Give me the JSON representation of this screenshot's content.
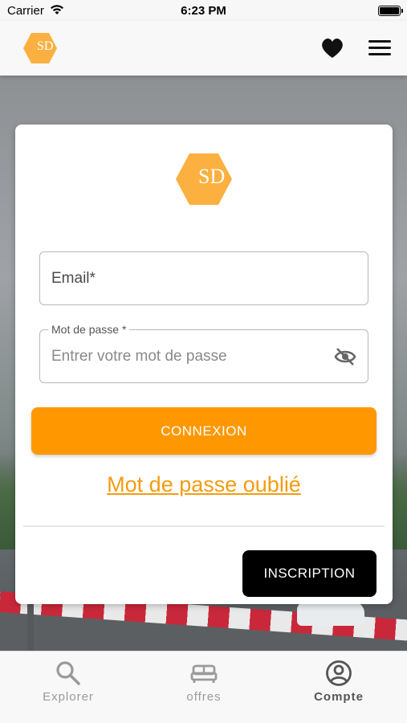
{
  "status_bar": {
    "carrier": "Carrier",
    "time": "6:23 PM"
  },
  "app_bar": {
    "logo_text": "SD",
    "icons": [
      "heart-icon",
      "menu-icon"
    ]
  },
  "login": {
    "logo_text": "SD",
    "email_placeholder": "Email*",
    "email_value": "",
    "password_label": "Mot de passe *",
    "password_placeholder": "Entrer votre mot de passe",
    "password_value": "",
    "connexion_label": "CONNEXION",
    "forgot_label": "Mot de passe oublié",
    "inscription_label": "INSCRIPTION"
  },
  "bottom_nav": {
    "items": [
      {
        "label": "Explorer",
        "icon": "search-icon",
        "active": false
      },
      {
        "label": "offres",
        "icon": "bed-icon",
        "active": false
      },
      {
        "label": "Compte",
        "icon": "account-icon",
        "active": true
      }
    ]
  },
  "colors": {
    "accent": "#ff9800",
    "link": "#f39c12",
    "logo": "#fbb040",
    "dark_button": "#000000"
  }
}
